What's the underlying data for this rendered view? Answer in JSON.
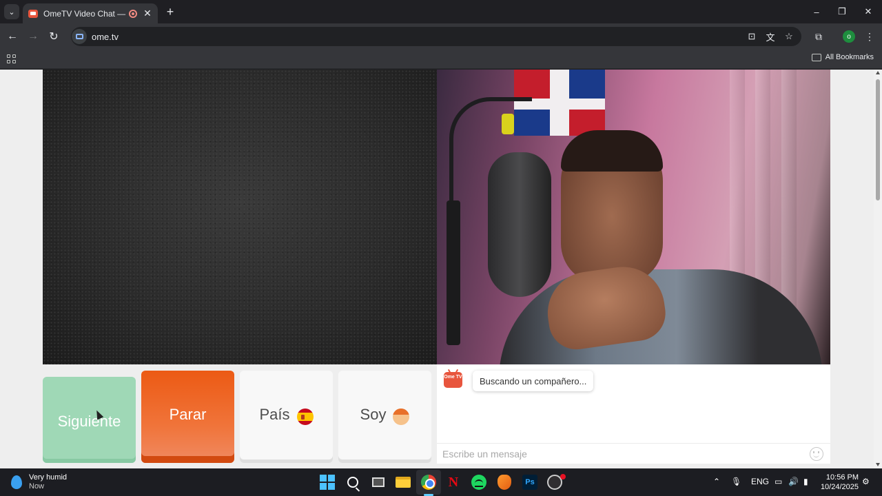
{
  "browser": {
    "tab_title": "OmeTV Video Chat — Ome",
    "url": "ome.tv",
    "bookmarks_label": "All Bookmarks",
    "profile_initial": "o",
    "icons": {
      "tab_search": "⌄",
      "close": "✕",
      "new_tab": "+",
      "back": "←",
      "forward": "→",
      "reload": "↻",
      "install": "⊡",
      "translate": "文",
      "star": "☆",
      "extensions": "⧉",
      "menu": "⋮",
      "minimize": "–",
      "maximize": "❐",
      "window_close": "✕"
    }
  },
  "controls": {
    "next_label": "Siguiente",
    "stop_label": "Parar",
    "country_label": "País",
    "gender_label": "Soy"
  },
  "chat": {
    "logo_text": "Ome TV",
    "status_message": "Buscando un compañero...",
    "input_placeholder": "Escribe un mensaje"
  },
  "taskbar": {
    "weather_condition": "Very humid",
    "weather_time": "Now",
    "language": "ENG",
    "time": "10:56 PM",
    "date": "10/24/2025",
    "netflix_glyph": "N",
    "photoshop_glyph": "Ps",
    "tray_up": "⌃",
    "mic": "🎙",
    "display": "▭",
    "volume": "🔊",
    "battery": "▮",
    "notifications": "⚙"
  },
  "colors": {
    "next_button": "#9fd8b6",
    "stop_button": "#ec5a14",
    "accent": "#e8553d"
  }
}
